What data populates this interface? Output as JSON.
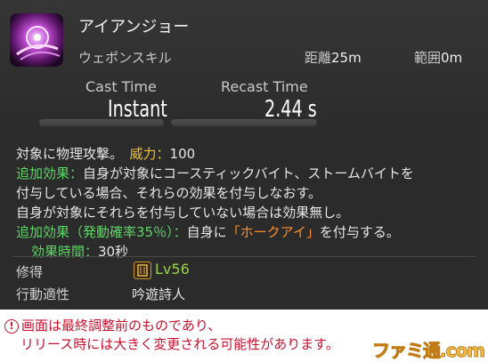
{
  "skill": {
    "name": "アイアンジョー",
    "type": "ウェポンスキル",
    "range_label": "距離",
    "range_value": "25m",
    "radius_label": "範囲",
    "radius_value": "0m",
    "icon": "iron-jaws-skill-icon"
  },
  "timing": {
    "cast_label": "Cast Time",
    "cast_value": "Instant",
    "recast_label": "Recast Time",
    "recast_value": "2.44 s"
  },
  "description": {
    "line1_text": "対象に物理攻撃。",
    "potency_label": "威力：",
    "potency_value": "100",
    "effect_label": "追加効果：",
    "line2_text": "自身が対象にコースティックバイト、ストームバイトを",
    "line3_text": "付与している場合、それらの効果を付与しなおす。",
    "line4_text": "自身が対象にそれらを付与していない場合は効果無し。",
    "effect2_label": "追加効果（発動確率35％）：",
    "line5_a": "自身に",
    "buff_name": "「ホークアイ」",
    "line5_b": "を付与する。",
    "duration_label": "効果時間：",
    "duration_value": "30秒"
  },
  "meta": {
    "acquired_label": "修得",
    "level": "Lv56",
    "class_label": "行動適性",
    "class_value": "吟遊詩人"
  },
  "notice": {
    "line1": "画面は最終調整前のものであり、",
    "line2": "リリース時には大きく変更される可能性があります。",
    "icon": "!"
  },
  "watermark": "ファミ通.com",
  "colors": {
    "tooltip_bg": "#2b2b2b",
    "label_green": "#5fd468",
    "potency_yellow": "#f1c232",
    "buff_orange": "#ff8e2b",
    "level_green": "#9dd14b",
    "notice_red": "#c8102e"
  }
}
